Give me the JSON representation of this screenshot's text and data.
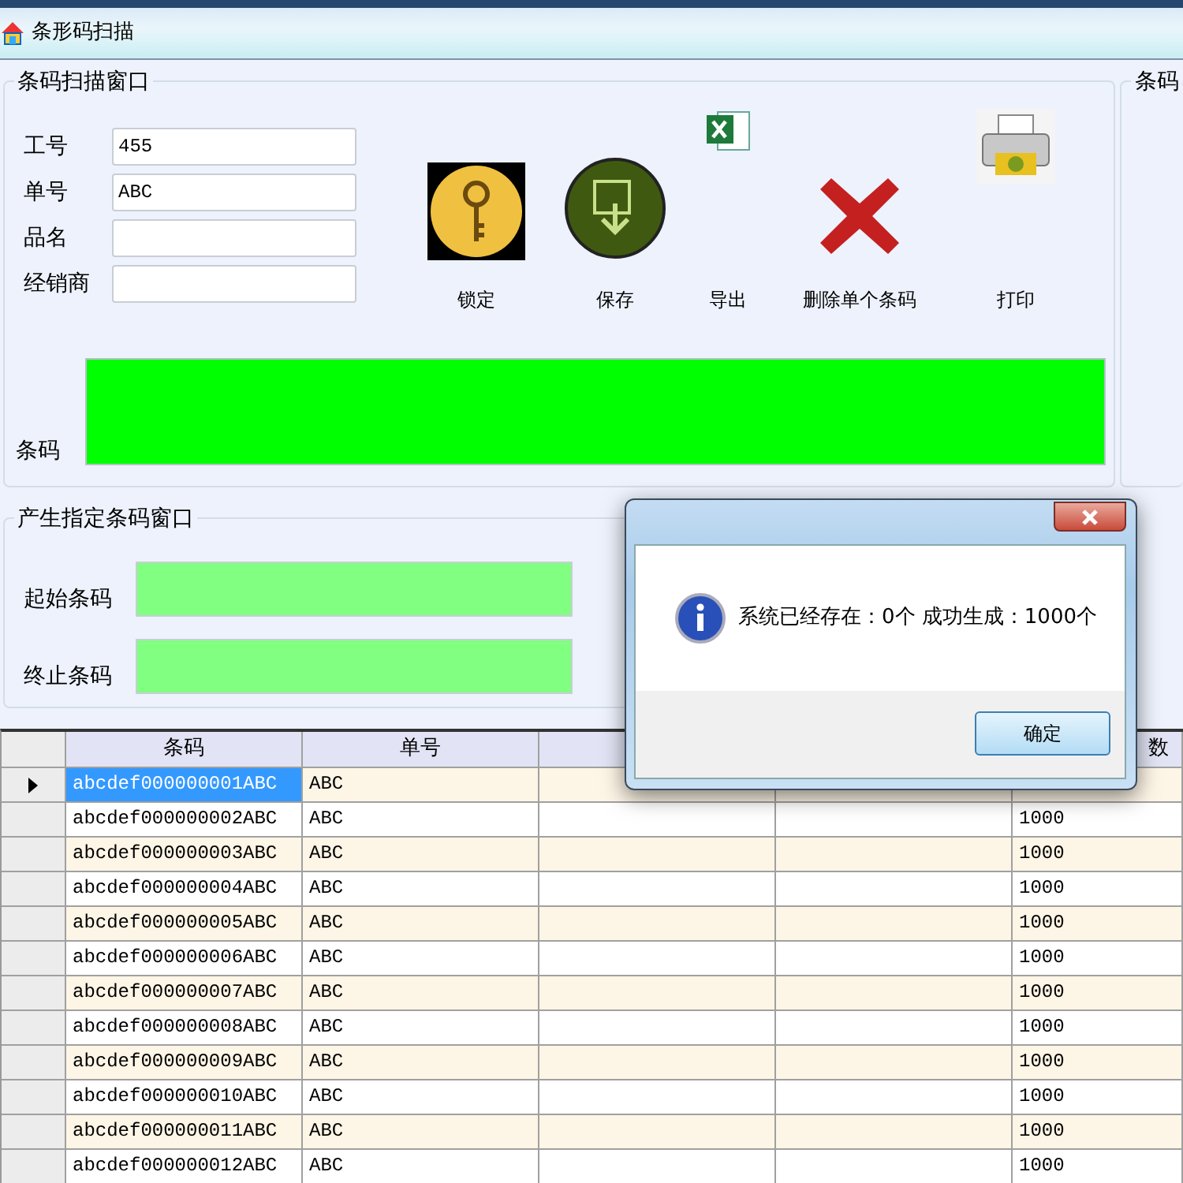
{
  "window": {
    "title": "条形码扫描"
  },
  "scan_group": {
    "title": "条码扫描窗口",
    "fields": [
      {
        "label": "工号",
        "value": "455"
      },
      {
        "label": "单号",
        "value": "ABC"
      },
      {
        "label": "品名"
      },
      {
        "label": "经销商"
      }
    ],
    "tools": [
      {
        "kind": "lock",
        "label": "锁定"
      },
      {
        "kind": "save",
        "label": "保存"
      },
      {
        "kind": "export",
        "label": "导出"
      },
      {
        "kind": "delete",
        "label": "删除单个条码"
      },
      {
        "kind": "print",
        "label": "打印"
      }
    ],
    "barcode": {
      "label": "条码"
    }
  },
  "right_group": {
    "title": "条码"
  },
  "generate_group": {
    "title": "产生指定条码窗口",
    "fields": [
      {
        "label": "起始条码"
      },
      {
        "label": "终止条码"
      }
    ]
  },
  "table": {
    "columns": [
      {
        "label": "条码"
      },
      {
        "label": "单号"
      },
      {},
      {},
      {
        "label": "数"
      }
    ],
    "rows": [
      {
        "selected": true,
        "code": "abcdef000000001ABC",
        "order": "ABC"
      },
      {
        "selected": false,
        "code": "abcdef000000002ABC",
        "order": "ABC",
        "count": "1000"
      },
      {
        "selected": false,
        "code": "abcdef000000003ABC",
        "order": "ABC",
        "count": "1000"
      },
      {
        "selected": false,
        "code": "abcdef000000004ABC",
        "order": "ABC",
        "count": "1000"
      },
      {
        "selected": false,
        "code": "abcdef000000005ABC",
        "order": "ABC",
        "count": "1000"
      },
      {
        "selected": false,
        "code": "abcdef000000006ABC",
        "order": "ABC",
        "count": "1000"
      },
      {
        "selected": false,
        "code": "abcdef000000007ABC",
        "order": "ABC",
        "count": "1000"
      },
      {
        "selected": false,
        "code": "abcdef000000008ABC",
        "order": "ABC",
        "count": "1000"
      },
      {
        "selected": false,
        "code": "abcdef000000009ABC",
        "order": "ABC",
        "count": "1000"
      },
      {
        "selected": false,
        "code": "abcdef000000010ABC",
        "order": "ABC",
        "count": "1000"
      },
      {
        "selected": false,
        "code": "abcdef000000011ABC",
        "order": "ABC",
        "count": "1000"
      },
      {
        "selected": false,
        "code": "abcdef000000012ABC",
        "order": "ABC",
        "count": "1000"
      }
    ]
  },
  "dialog": {
    "message": "系统已经存在：0个 成功生成：1000个",
    "button": "确定"
  }
}
